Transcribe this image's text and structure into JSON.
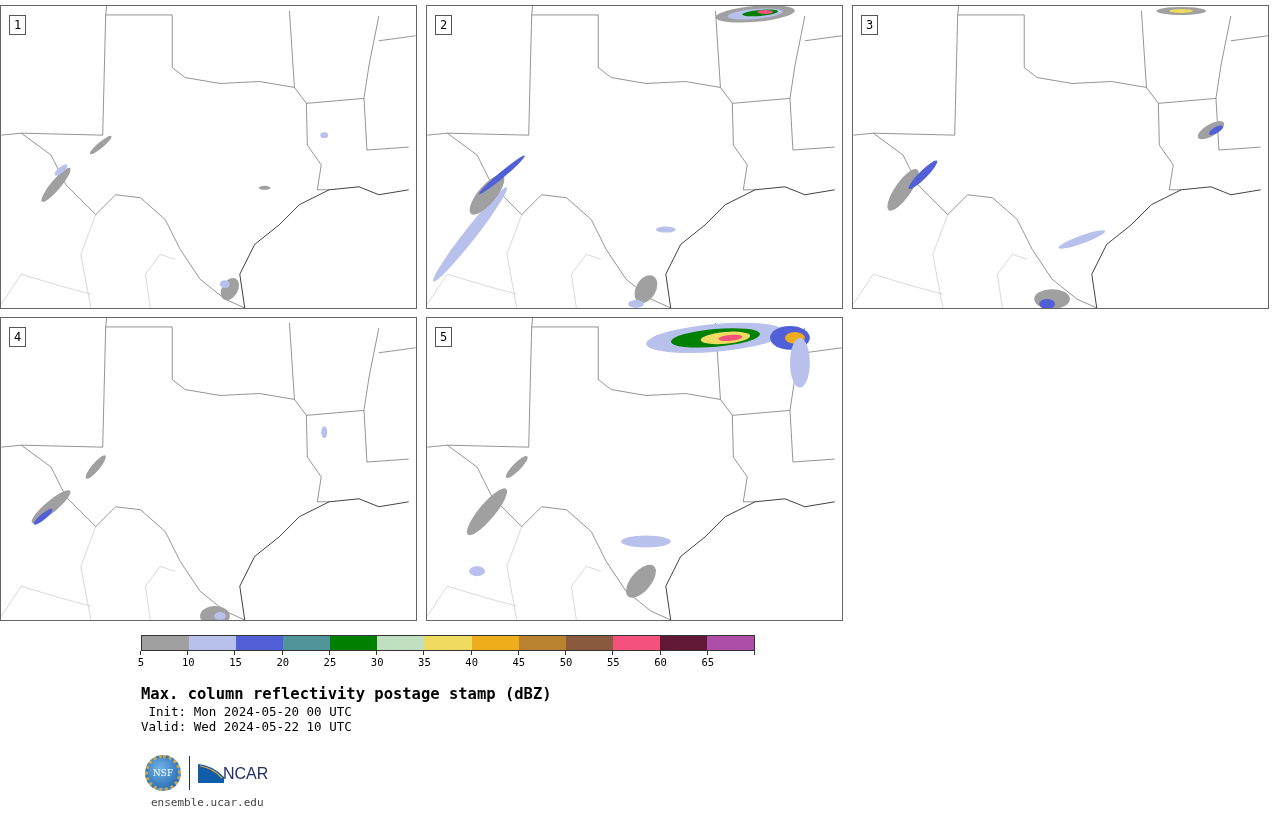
{
  "panels": [
    {
      "number": "1"
    },
    {
      "number": "2"
    },
    {
      "number": "3"
    },
    {
      "number": "4"
    },
    {
      "number": "5"
    }
  ],
  "colorbar": {
    "segments": [
      {
        "color": "#a0a0a0",
        "label": "5"
      },
      {
        "color": "#b7c1ec",
        "label": "10"
      },
      {
        "color": "#5160d6",
        "label": "15"
      },
      {
        "color": "#4f9599",
        "label": "20"
      },
      {
        "color": "#008000",
        "label": "25"
      },
      {
        "color": "#bfdfbf",
        "label": "30"
      },
      {
        "color": "#efdb5f",
        "label": "35"
      },
      {
        "color": "#efac1b",
        "label": "40"
      },
      {
        "color": "#b9822f",
        "label": "45"
      },
      {
        "color": "#8a5a3e",
        "label": "50"
      },
      {
        "color": "#f5517d",
        "label": "55"
      },
      {
        "color": "#611736",
        "label": "60"
      },
      {
        "color": "#ad4fa8",
        "label": "65"
      }
    ]
  },
  "title": "Max. column reflectivity postage stamp (dBZ)",
  "init": "Init: Mon 2024-05-20 00 UTC",
  "valid": "Valid: Wed 2024-05-22 10 UTC",
  "logo": {
    "nsf": "NSF",
    "ncar": "NCAR"
  },
  "url": "ensemble.ucar.edu"
}
